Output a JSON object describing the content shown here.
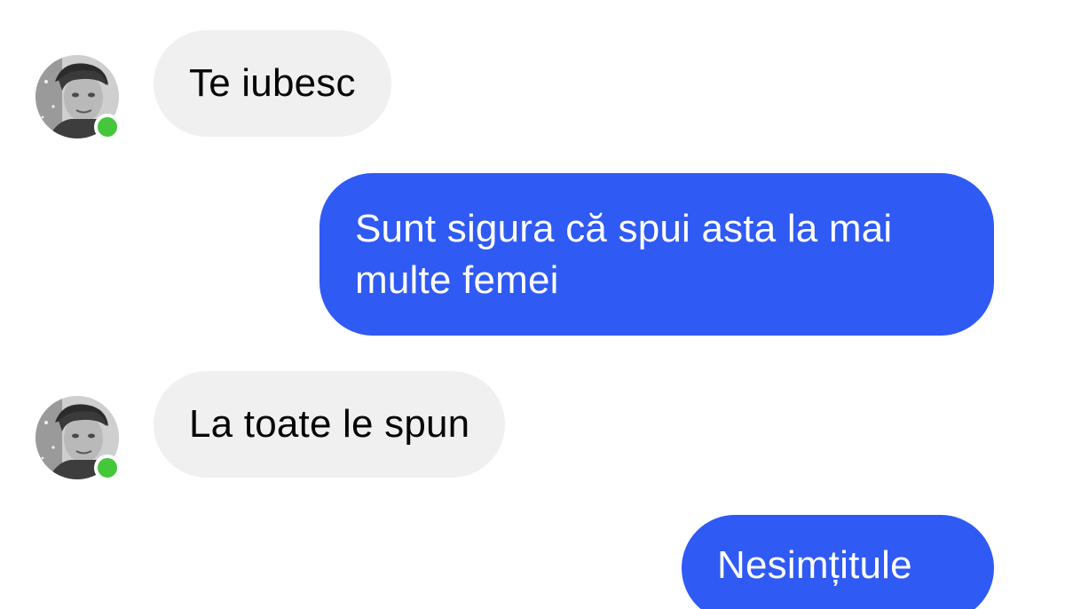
{
  "messages": [
    {
      "direction": "received",
      "text": "Te iubesc"
    },
    {
      "direction": "sent",
      "text": "Sunt sigura că spui asta la mai multe femei"
    },
    {
      "direction": "received",
      "text": "La toate le spun"
    },
    {
      "direction": "sent",
      "text": "Nesimțitule"
    }
  ],
  "contact": {
    "online": true,
    "avatar_icon": "person-photo-icon",
    "presence_color": "#44c73b"
  },
  "colors": {
    "sent_bubble": "#2f5af4",
    "received_bubble": "#f0f0f0",
    "background": "#ffffff"
  }
}
